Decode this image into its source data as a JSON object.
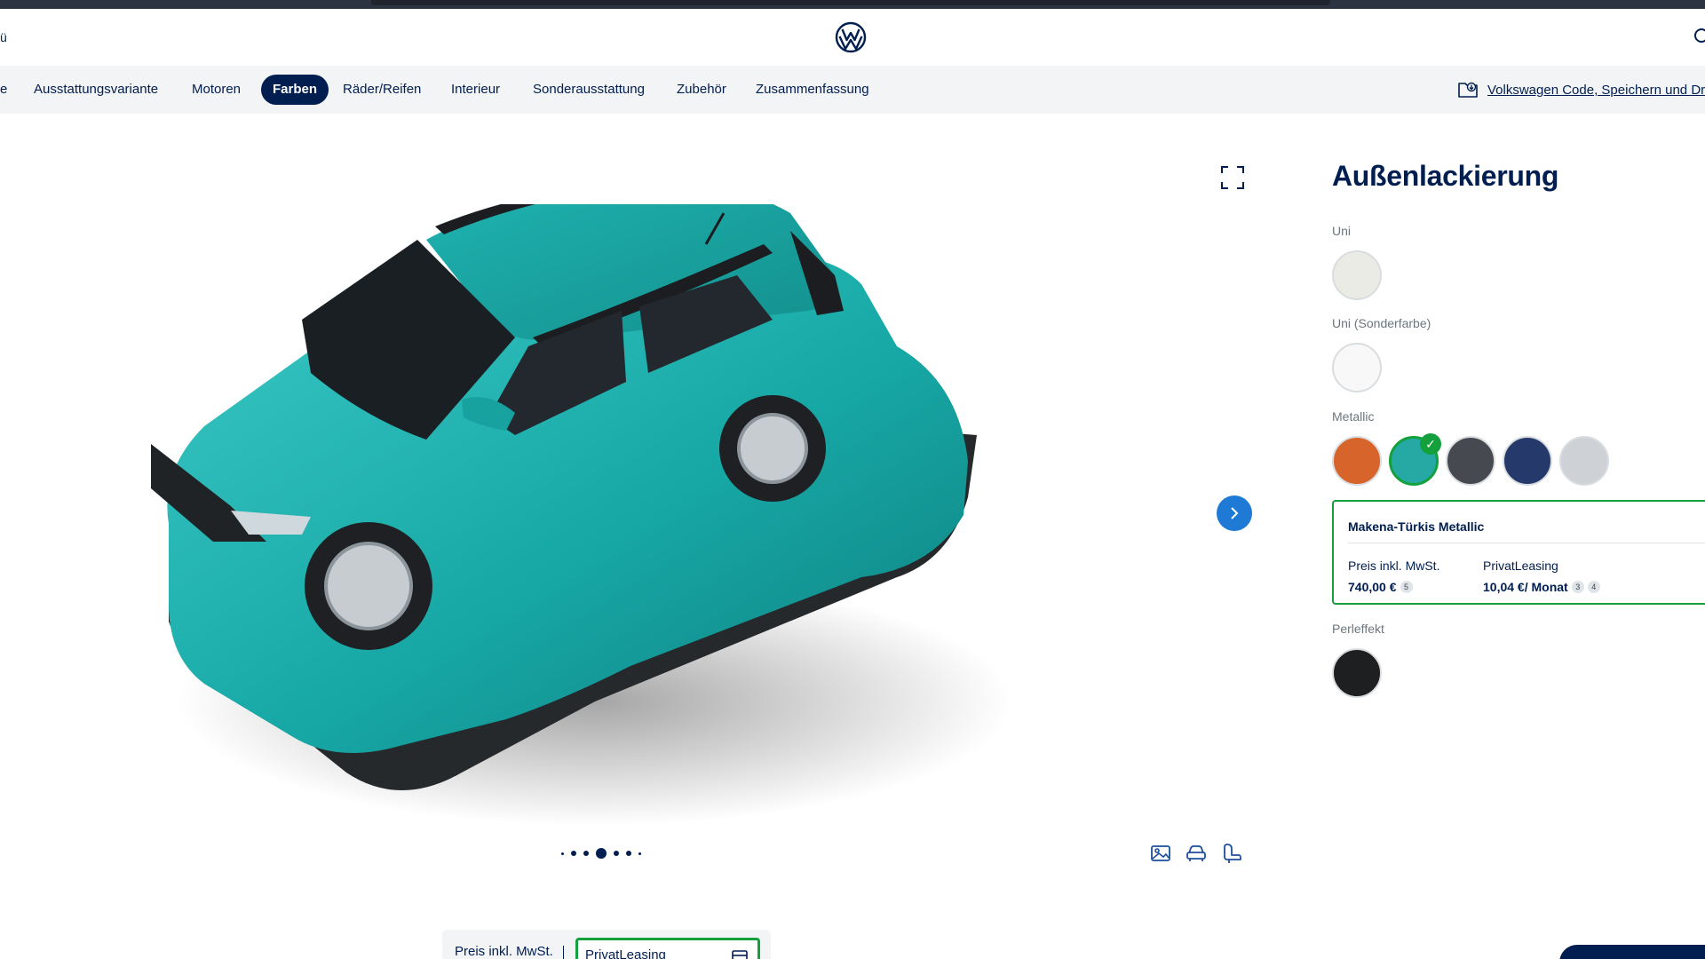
{
  "header": {
    "left_text": "ü",
    "brand": "Volkswagen",
    "faint_text": ""
  },
  "tabs": [
    {
      "label": "e",
      "active": false
    },
    {
      "label": "Ausstattungsvariante",
      "active": false
    },
    {
      "label": "Motoren",
      "active": false
    },
    {
      "label": "Farben",
      "active": true
    },
    {
      "label": "Räder/Reifen",
      "active": false
    },
    {
      "label": "Interieur",
      "active": false
    },
    {
      "label": "Sonderausstattung",
      "active": false
    },
    {
      "label": "Zubehör",
      "active": false
    },
    {
      "label": "Zusammenfassung",
      "active": false
    }
  ],
  "save_link": "Volkswagen Code, Speichern und Drucken",
  "carousel": {
    "dot_count": 7,
    "active_dot": 3
  },
  "view_icons": [
    "image-icon",
    "car-exterior-icon",
    "seat-interior-icon"
  ],
  "price_bar": {
    "label": "Preis inkl. MwSt.",
    "select_value": "PrivatLeasing"
  },
  "panel": {
    "title": "Außenlackierung",
    "groups": {
      "uni": {
        "label": "Uni",
        "colors": [
          "#ebebe6"
        ]
      },
      "uni_sonder": {
        "label": "Uni (Sonderfarbe)",
        "colors": [
          "#f8f8f8"
        ]
      },
      "metallic": {
        "label": "Metallic",
        "colors": [
          "#d7642a",
          "#26a9a4",
          "#46494f",
          "#253a6b",
          "#ced2d6"
        ],
        "selected": 1
      },
      "perleffekt": {
        "label": "Perleffekt",
        "colors": [
          "#1e1f21"
        ]
      }
    },
    "selected_color": {
      "name": "Makena-Türkis Metallic",
      "price_label": "Preis inkl. MwSt.",
      "price_value": "740,00 €",
      "price_footnote": "5",
      "leasing_label": "PrivatLeasing",
      "leasing_value": "10,04 €/ Monat",
      "leasing_footnotes": [
        "3",
        "4"
      ]
    }
  },
  "colors": {
    "brand_navy": "#001e50",
    "accent_green": "#14a03c",
    "accent_blue": "#1f7ad6",
    "car_body": "#1fb2b0"
  }
}
